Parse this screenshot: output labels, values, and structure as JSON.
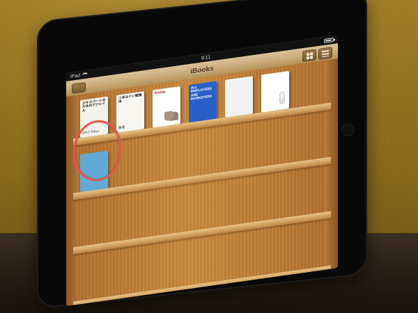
{
  "scene": {
    "status_bar": {
      "left": "iPad",
      "time": "9:11"
    },
    "ibooks": {
      "title": "iBooks",
      "controls": {
        "left_button_icon": "back-icon",
        "grid_view_icon": "grid-icon",
        "list_view_icon": "list-icon"
      }
    },
    "shelves": [
      {
        "books": [
          {
            "title": "エキスパートのためのアジャイル",
            "meta": "2010  Tokyo",
            "author": "",
            "style": "b1"
          },
          {
            "title": "つまみぐい勉強法",
            "meta": "",
            "author": "著者",
            "style": "b2"
          },
          {
            "title": "Erlang",
            "meta": "",
            "author": "",
            "style": "b3",
            "icon": "kangaroo-icon"
          },
          {
            "title": "ALL EMPLOYEES ARE MARKETERS",
            "meta": "",
            "author": "",
            "style": "b4"
          },
          {
            "title": "",
            "meta": "",
            "author": "",
            "style": "b5"
          },
          {
            "title": "",
            "meta": "",
            "author": "",
            "style": "b6",
            "icon": "pencil-icon"
          }
        ]
      },
      {
        "books": [
          {
            "title": "",
            "meta": "",
            "author": "",
            "style": "b7"
          }
        ]
      },
      {
        "books": []
      },
      {
        "books": []
      }
    ]
  },
  "colors": {
    "annotation": "#e25a4b"
  }
}
